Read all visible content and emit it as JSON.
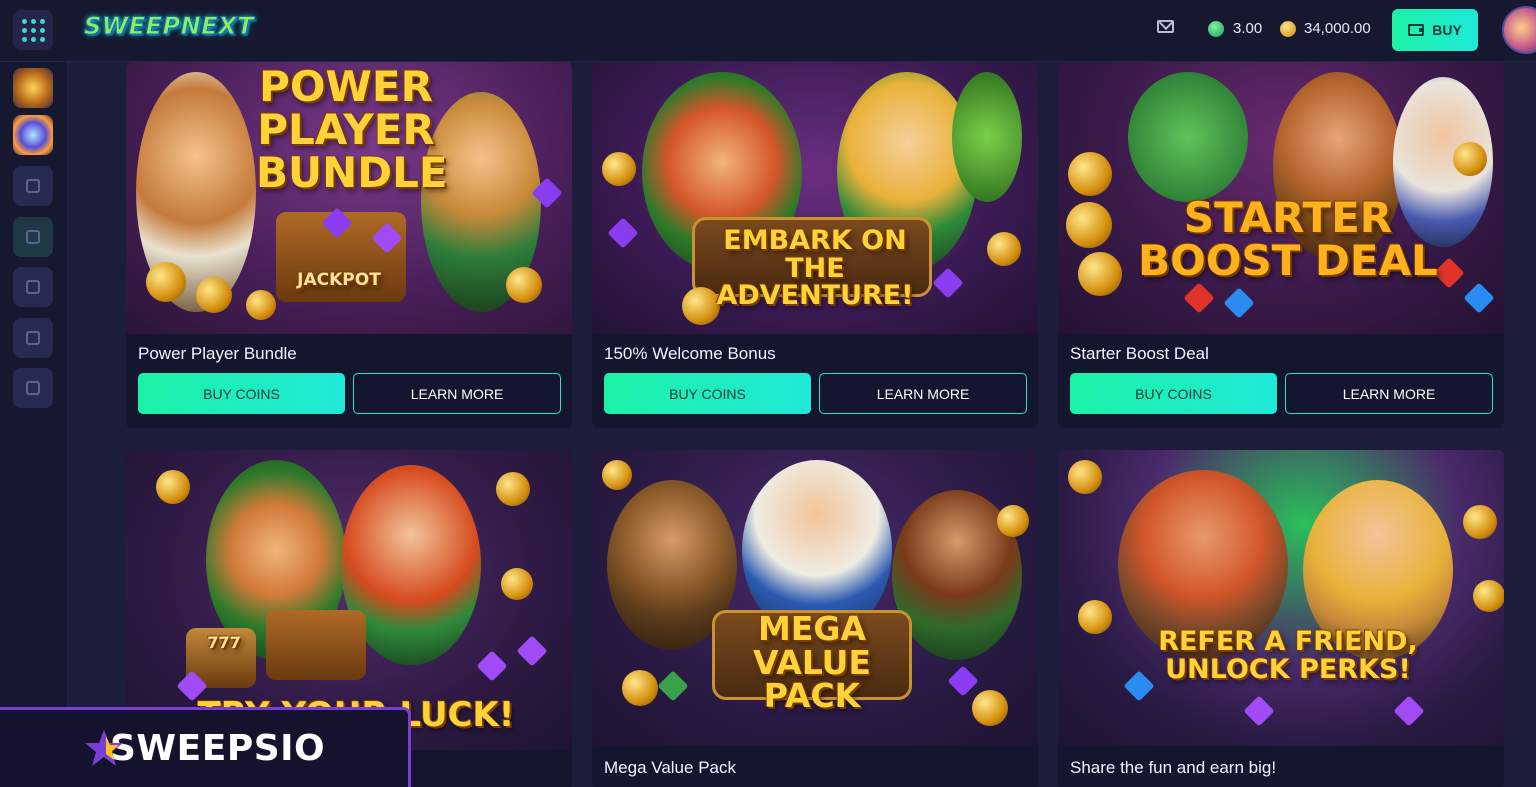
{
  "header": {
    "logo_text": "SWEEPNEXT",
    "sc_balance": "3.00",
    "gc_balance": "34,000.00",
    "buy_label": "BUY",
    "icons": [
      "apps-grid-icon",
      "mail-icon",
      "sweeps-coin-icon",
      "gold-coin-icon",
      "wallet-icon",
      "user-avatar"
    ]
  },
  "sidebar": {
    "items": [
      "promo-game-thumb",
      "wheel-game-thumb",
      "home-icon",
      "gift-icon",
      "wallet-icon",
      "dice-icon",
      "chat-icon"
    ]
  },
  "cards": [
    {
      "headline": "POWER PLAYER BUNDLE",
      "art_text": "JACKPOT",
      "title": "Power Player Bundle",
      "buy_label": "BUY COINS",
      "learn_label": "LEARN MORE"
    },
    {
      "headline": "EMBARK ON THE ADVENTURE!",
      "title": "150% Welcome Bonus",
      "buy_label": "BUY COINS",
      "learn_label": "LEARN MORE"
    },
    {
      "headline": "STARTER BOOST DEAL",
      "title": "Starter Boost Deal",
      "buy_label": "BUY COINS",
      "learn_label": "LEARN MORE"
    },
    {
      "headline": "TRY YOUR LUCK!",
      "art_text": "777",
      "title": "",
      "buy_label": "",
      "learn_label": ""
    },
    {
      "headline": "MEGA VALUE PACK",
      "title": "Mega Value Pack",
      "buy_label": "",
      "learn_label": ""
    },
    {
      "headline": "REFER A FRIEND, UNLOCK PERKS!",
      "title": "Share the fun and earn big!",
      "buy_label": "",
      "learn_label": ""
    }
  ],
  "watermark": {
    "text": "SWEEPSIO"
  },
  "colors": {
    "accent": "#1ee8d8",
    "accent_green": "#1cf2a6",
    "background": "#1b1d3a",
    "panel": "#16182f",
    "headline_gold": "#ffd23a"
  }
}
